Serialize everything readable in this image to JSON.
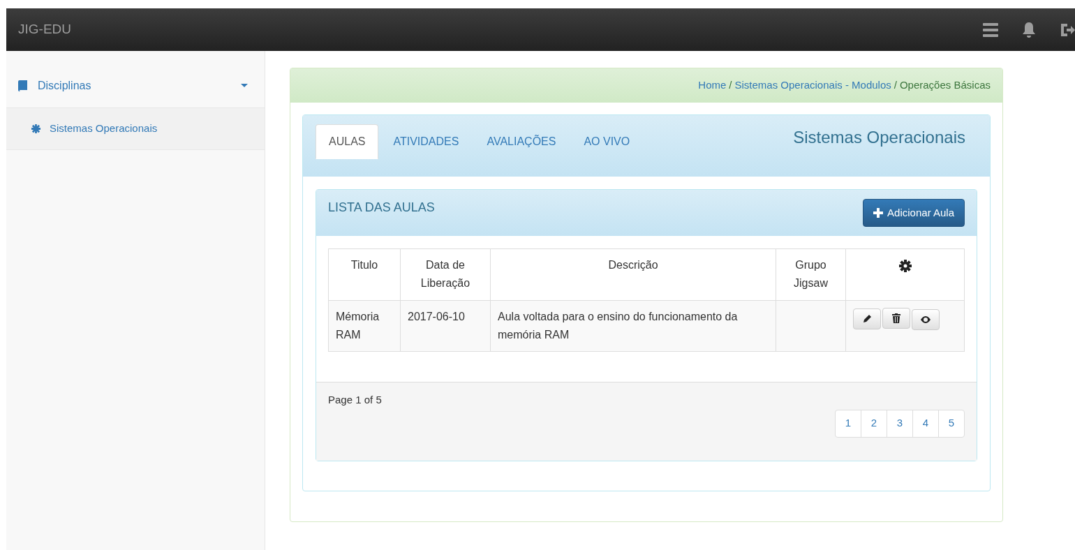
{
  "navbar": {
    "brand": "JIG-EDU"
  },
  "sidebar": {
    "items": [
      {
        "label": "Disciplinas",
        "expanded": true,
        "children": [
          {
            "label": "Sistemas Operacionais"
          }
        ]
      }
    ]
  },
  "breadcrumb": {
    "separator": "/",
    "items": [
      {
        "label": "Home",
        "kind": "link"
      },
      {
        "label": "Sistemas Operacionais - Modulos",
        "kind": "link"
      },
      {
        "label": "Operações Básicas",
        "kind": "current"
      }
    ]
  },
  "tabs": [
    {
      "label": "AULAS",
      "selected": true
    },
    {
      "label": "ATIVIDADES",
      "selected": false
    },
    {
      "label": "AVALIAÇÕES",
      "selected": false
    },
    {
      "label": "AO VIVO",
      "selected": false
    }
  ],
  "course_title": "Sistemas Operacionais",
  "list": {
    "title": "LISTA DAS AULAS",
    "add_button": "Adicionar Aula",
    "table": {
      "columns": [
        "Titulo",
        "Data de Liberação",
        "Descrição",
        "Grupo Jigsaw"
      ],
      "rows": [
        {
          "cells": [
            "Mémoria RAM",
            "2017-06-10",
            "Aula voltada para o ensino do funcionamento da memória RAM",
            ""
          ]
        }
      ]
    },
    "page_info": "Page 1 of 5",
    "pages": [
      {
        "label": "1",
        "selected": false
      },
      {
        "label": "2",
        "selected": false
      },
      {
        "label": "3",
        "selected": false
      },
      {
        "label": "4",
        "selected": false
      },
      {
        "label": "5",
        "selected": false
      }
    ]
  }
}
